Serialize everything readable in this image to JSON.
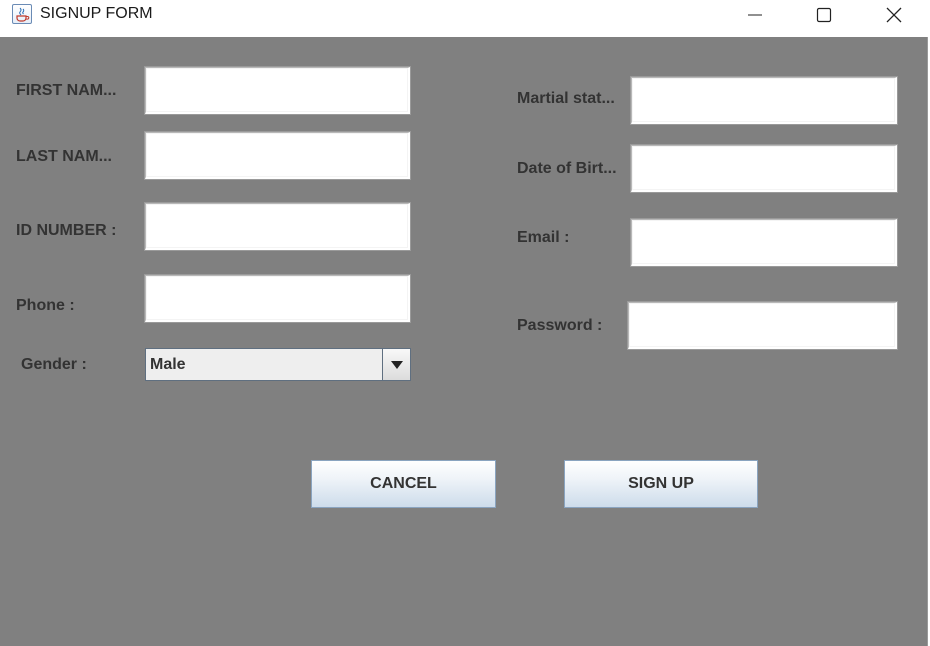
{
  "window": {
    "title": "SIGNUP FORM"
  },
  "labels": {
    "first_name": "FIRST NAM...",
    "last_name": "LAST NAM...",
    "id_number": "ID NUMBER :",
    "phone": "Phone :",
    "gender": "Gender :",
    "marital_status": "Martial stat...",
    "date_of_birth": "Date of Birt...",
    "email": "Email :",
    "password": "Password :"
  },
  "values": {
    "first_name": "",
    "last_name": "",
    "id_number": "",
    "phone": "",
    "marital_status": "",
    "date_of_birth": "",
    "email": "",
    "password": ""
  },
  "gender": {
    "selected": "Male"
  },
  "buttons": {
    "cancel": "CANCEL",
    "signup": "SIGN UP"
  },
  "icons": {
    "app": "java-coffee-cup-icon",
    "minimize": "minimize-icon",
    "maximize": "maximize-icon",
    "close": "close-icon",
    "dropdown": "triangle-down-icon"
  }
}
